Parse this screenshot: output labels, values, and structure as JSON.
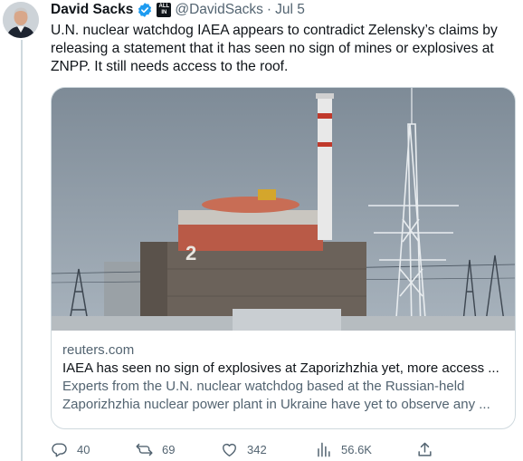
{
  "author": {
    "display_name": "David Sacks",
    "handle": "@DavidSacks",
    "separator": "·",
    "time": "Jul 5",
    "affiliate_badge": "ALL IN",
    "verified_color": "#1d9bf0"
  },
  "tweet": {
    "text": "U.N. nuclear watchdog IAEA appears to contradict Zelensky’s claims by releasing a statement that it has seen no sign of mines or explosives at ZNPP. It still needs access to the roof."
  },
  "card": {
    "domain": "reuters.com",
    "title": "IAEA has seen no sign of explosives at Zaporizhzhia yet, more access ...",
    "description": "Experts from the U.N. nuclear watchdog based at the Russian-held Zaporizhzhia nuclear power plant in Ukraine have yet to observe any ...",
    "image_text": "2"
  },
  "actions": {
    "replies": "40",
    "retweets": "69",
    "likes": "342",
    "views": "56.6K"
  },
  "icons": [
    "verified-icon",
    "reply-icon",
    "retweet-icon",
    "like-icon",
    "views-icon",
    "share-icon"
  ]
}
